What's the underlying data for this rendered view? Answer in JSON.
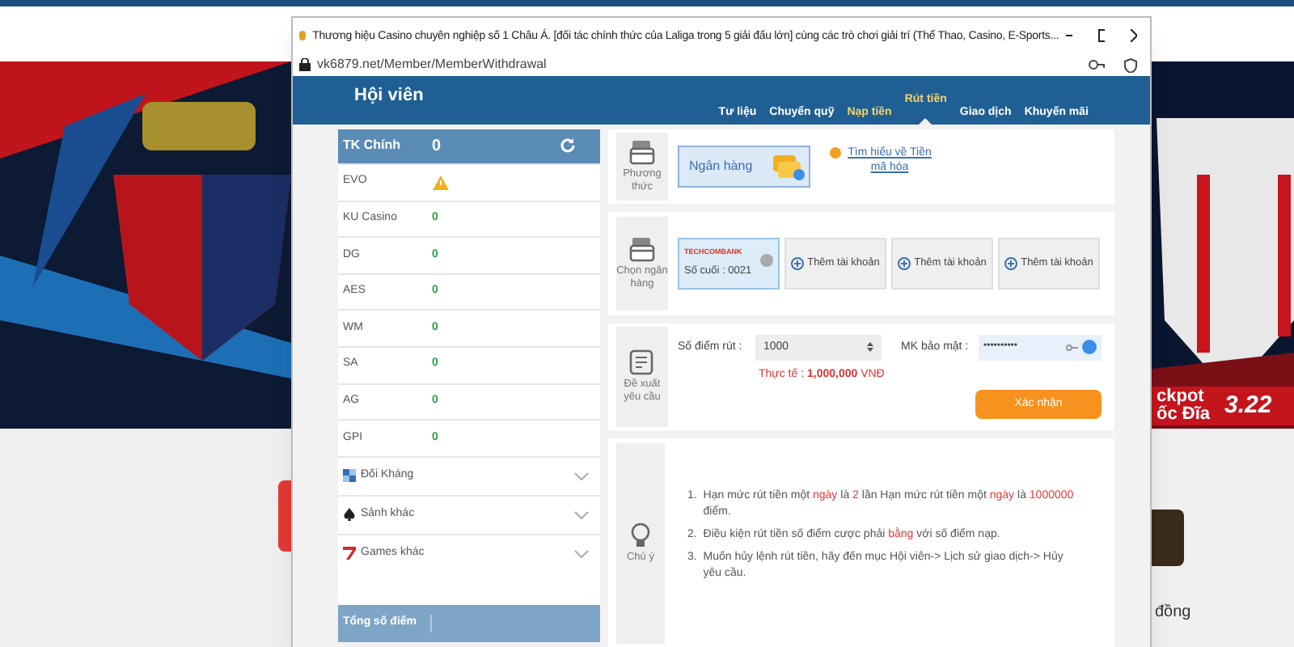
{
  "backdrop": {
    "jackpot_label": [
      "ckpot",
      "ốc Đĩa"
    ],
    "jackpot_value": "3.22",
    "caption": "đồng"
  },
  "popup": {
    "title": "Thương hiệu Casino chuyên nghiệp số 1 Châu Á. [đối tác chính thức của Laliga trong 5 giải đấu lớn] cùng các trò chơi giải trí (Thể Thao, Casino, E-Sports...",
    "url": "vk6879.net/Member/MemberWithdrawal"
  },
  "header": {
    "title": "Hội viên",
    "nav": [
      {
        "label": "Tư liệu",
        "kind": "plain",
        "selected": false
      },
      {
        "label": "Chuyển quỹ",
        "kind": "plain",
        "selected": false
      },
      {
        "label": "Nạp tiền",
        "kind": "money",
        "selected": false
      },
      {
        "label": "Rút tiền",
        "kind": "money",
        "selected": true
      },
      {
        "label": "Giao dịch",
        "kind": "plain",
        "selected": false
      },
      {
        "label": "Khuyến mãi",
        "kind": "plain",
        "selected": false
      }
    ]
  },
  "wallets": {
    "main": {
      "label": "TK Chính",
      "value": "0"
    },
    "items": [
      {
        "name": "EVO",
        "kind": "warning"
      },
      {
        "name": "KU Casino",
        "kind": "value",
        "value": "0"
      },
      {
        "name": "DG",
        "kind": "value",
        "value": "0"
      },
      {
        "name": "AES",
        "kind": "value",
        "value": "0"
      },
      {
        "name": "WM",
        "kind": "value",
        "value": "0"
      },
      {
        "name": "SA",
        "kind": "value",
        "value": "0"
      },
      {
        "name": "AG",
        "kind": "value",
        "value": "0"
      },
      {
        "name": "GPI",
        "kind": "value",
        "value": "0"
      }
    ],
    "groups": [
      {
        "label": "Đối Kháng",
        "kind": "versus",
        "expanded": false
      },
      {
        "label": "Sảnh khác",
        "kind": "spade",
        "expanded": false
      },
      {
        "label": "Games khác",
        "kind": "seven",
        "expanded": false
      }
    ],
    "total": {
      "label": "Tổng số điểm"
    }
  },
  "method": {
    "label": "Phương thức",
    "options": [
      {
        "label": "Ngân hàng",
        "selected": true
      }
    ],
    "link": "Tìm hiểu về Tiền mã hóa"
  },
  "bank": {
    "label": "Chọn ngân hàng",
    "accounts": [
      {
        "kind": "bank",
        "bank": "TECHCOMBANK",
        "detail": "Số cuối : 0021",
        "selected": true
      },
      {
        "kind": "add",
        "label": "Thêm tài khoản",
        "selected": false
      },
      {
        "kind": "add",
        "label": "Thêm tài khoản",
        "selected": false
      },
      {
        "kind": "add",
        "label": "Thêm tài khoản",
        "selected": false
      }
    ]
  },
  "request": {
    "label": "Đề xuất yêu cầu",
    "amount_label": "Số điểm rút :",
    "amount": "1000",
    "password_label": "MK bảo mật :",
    "password": "••••••••••",
    "actual": "Thực tế : **1,000,000** VNĐ",
    "submit": "Xác nhận"
  },
  "note": {
    "label": "Chú ý",
    "rules": [
      {
        "number": "1.",
        "segments": [
          {
            "text": "Hạn mức rút tiền một ",
            "highlight": false
          },
          {
            "text": "ngày",
            "highlight": true
          },
          {
            "text": " là ",
            "highlight": false
          },
          {
            "text": "2",
            "highlight": true
          },
          {
            "text": " lần Hạn mức rút tiền một ",
            "highlight": false
          },
          {
            "text": "ngày",
            "highlight": true
          },
          {
            "text": " là ",
            "highlight": false
          },
          {
            "text": "1000000",
            "highlight": true
          },
          {
            "text": " điểm.",
            "highlight": false
          }
        ]
      },
      {
        "number": "2.",
        "segments": [
          {
            "text": "Điều kiện rút tiền số điểm cược phải ",
            "highlight": false
          },
          {
            "text": "bằng",
            "highlight": true
          },
          {
            "text": " với số điểm nạp.",
            "highlight": false
          }
        ]
      },
      {
        "number": "3.",
        "segments": [
          {
            "text": "Muốn hủy lệnh rút tiền, hãy đến mục Hội viên-> Lịch sử giao dịch-> Hủy yêu cầu.",
            "highlight": false
          }
        ]
      }
    ]
  }
}
